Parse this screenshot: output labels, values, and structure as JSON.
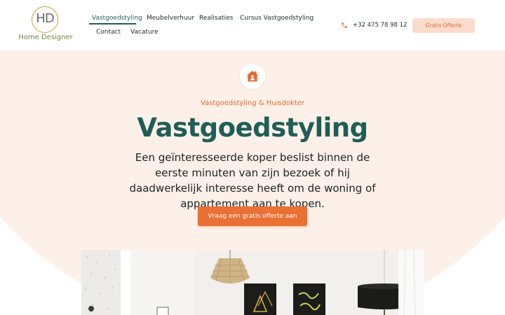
{
  "header": {
    "logo": {
      "mark": "HD",
      "text": "Home Designer"
    },
    "nav": [
      {
        "label": "Vastgoedstyling",
        "active": true
      },
      {
        "label": "Meubelverhuur",
        "active": false
      },
      {
        "label": "Realisaties",
        "active": false
      },
      {
        "label": "Cursus Vastgoedstyling",
        "active": false
      },
      {
        "label": "Contact",
        "active": false
      },
      {
        "label": "Vacature",
        "active": false
      }
    ],
    "phone": {
      "icon": "phone-icon",
      "number": "+32 475 78 98 12"
    },
    "cta_label": "Gratis Offerte"
  },
  "hero": {
    "icon": "house-icon",
    "eyebrow": "Vastgoedstyling & Huisdokter",
    "title": "Vastgoedstyling",
    "text": "Een geïnteresseerde koper beslist binnen de eerste minuten van zijn bezoek of hij daadwerkelijk interesse heeft om de woning of appartement aan te kopen.",
    "button_label": "Vraag een gratis offerte aan"
  },
  "colors": {
    "accent": "#ea7033",
    "brand_green": "#1f5e57",
    "hero_background": "#fdf0e8",
    "cta_soft": "#fadccc"
  }
}
